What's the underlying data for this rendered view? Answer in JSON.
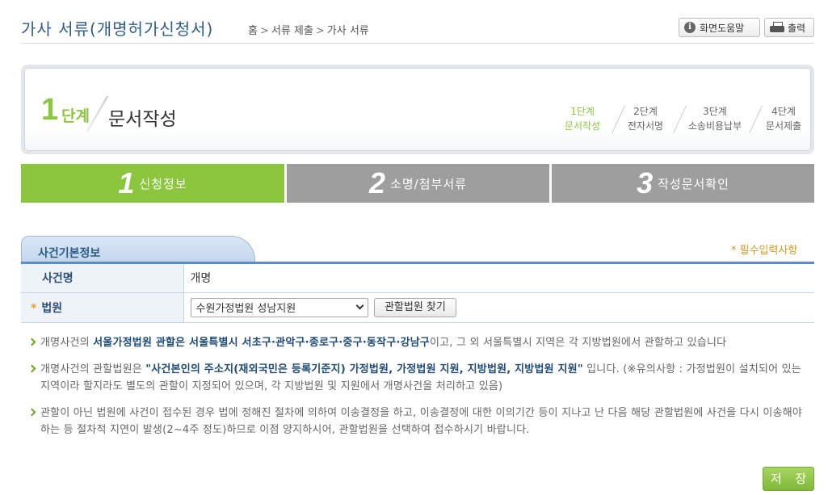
{
  "header": {
    "title": "가사 서류(개명허가신청서)",
    "breadcrumb": [
      "홈",
      "서류 제출",
      "가사 서류"
    ],
    "help_button": "화면도움말",
    "print_button": "출력"
  },
  "step_banner": {
    "number": "1",
    "unit": "단계",
    "name": "문서작성",
    "steps": [
      {
        "line1": "1단계",
        "line2": "문서작성",
        "active": true
      },
      {
        "line1": "2단계",
        "line2": "전자서명",
        "active": false
      },
      {
        "line1": "3단계",
        "line2": "소송비용납부",
        "active": false
      },
      {
        "line1": "4단계",
        "line2": "문서제출",
        "active": false
      }
    ]
  },
  "tabs": [
    {
      "num": "1",
      "label": "신청정보",
      "active": true
    },
    {
      "num": "2",
      "label": "소명/첨부서류",
      "active": false
    },
    {
      "num": "3",
      "label": "작성문서확인",
      "active": false
    }
  ],
  "section": {
    "title": "사건기본정보",
    "required_note": "* 필수입력사항"
  },
  "form": {
    "case_name_label": "사건명",
    "case_name_value": "개명",
    "court_required_mark": "*",
    "court_label": "법원",
    "court_selected": "수원가정법원 성남지원",
    "find_court_button": "관할법원 찾기"
  },
  "notes": [
    {
      "pre": "개명사건의 ",
      "bold": "서울가정법원 관할은 서울특별시 서초구·관악구·종로구·중구·동작구·강남구",
      "post": "이고, 그 외 서울특별시 지역은 각 지방법원에서 관할하고 있습니다"
    },
    {
      "pre": "개명사건의 관할법원은 ",
      "bold": "\"사건본인의 주소지(재외국민은 등록기준지) 가정법원, 가정법원 지원, 지방법원, 지방법원 지원\"",
      "post": " 입니다. (※유의사항 : 가정법원이 설치되어 있는 지역이라 할지라도 별도의 관할이 지정되어 있으며, 각 지방법원 및 지원에서 개명사건을 처리하고 있음)"
    },
    {
      "pre": "관할이 아닌 법원에 사건이 접수된 경우 법에 정해진 절차에 의하여 이송결정을 하고, 이송결정에 대한 이의기간 등이 지나고 난 다음 해당 관할법원에 사건을 다시 이송해야 하는 등 절차적 지연이 발생(2~4주 정도)하므로 이점 양지하시어, 관할법원을 선택하여 접수하시기 바랍니다.",
      "bold": "",
      "post": ""
    }
  ],
  "save_button": "저 장",
  "colors": {
    "accent_green": "#8cc63f",
    "inactive_gray": "#9e9e9e",
    "title_blue": "#2d5b8a",
    "required_orange": "#d39a25"
  }
}
